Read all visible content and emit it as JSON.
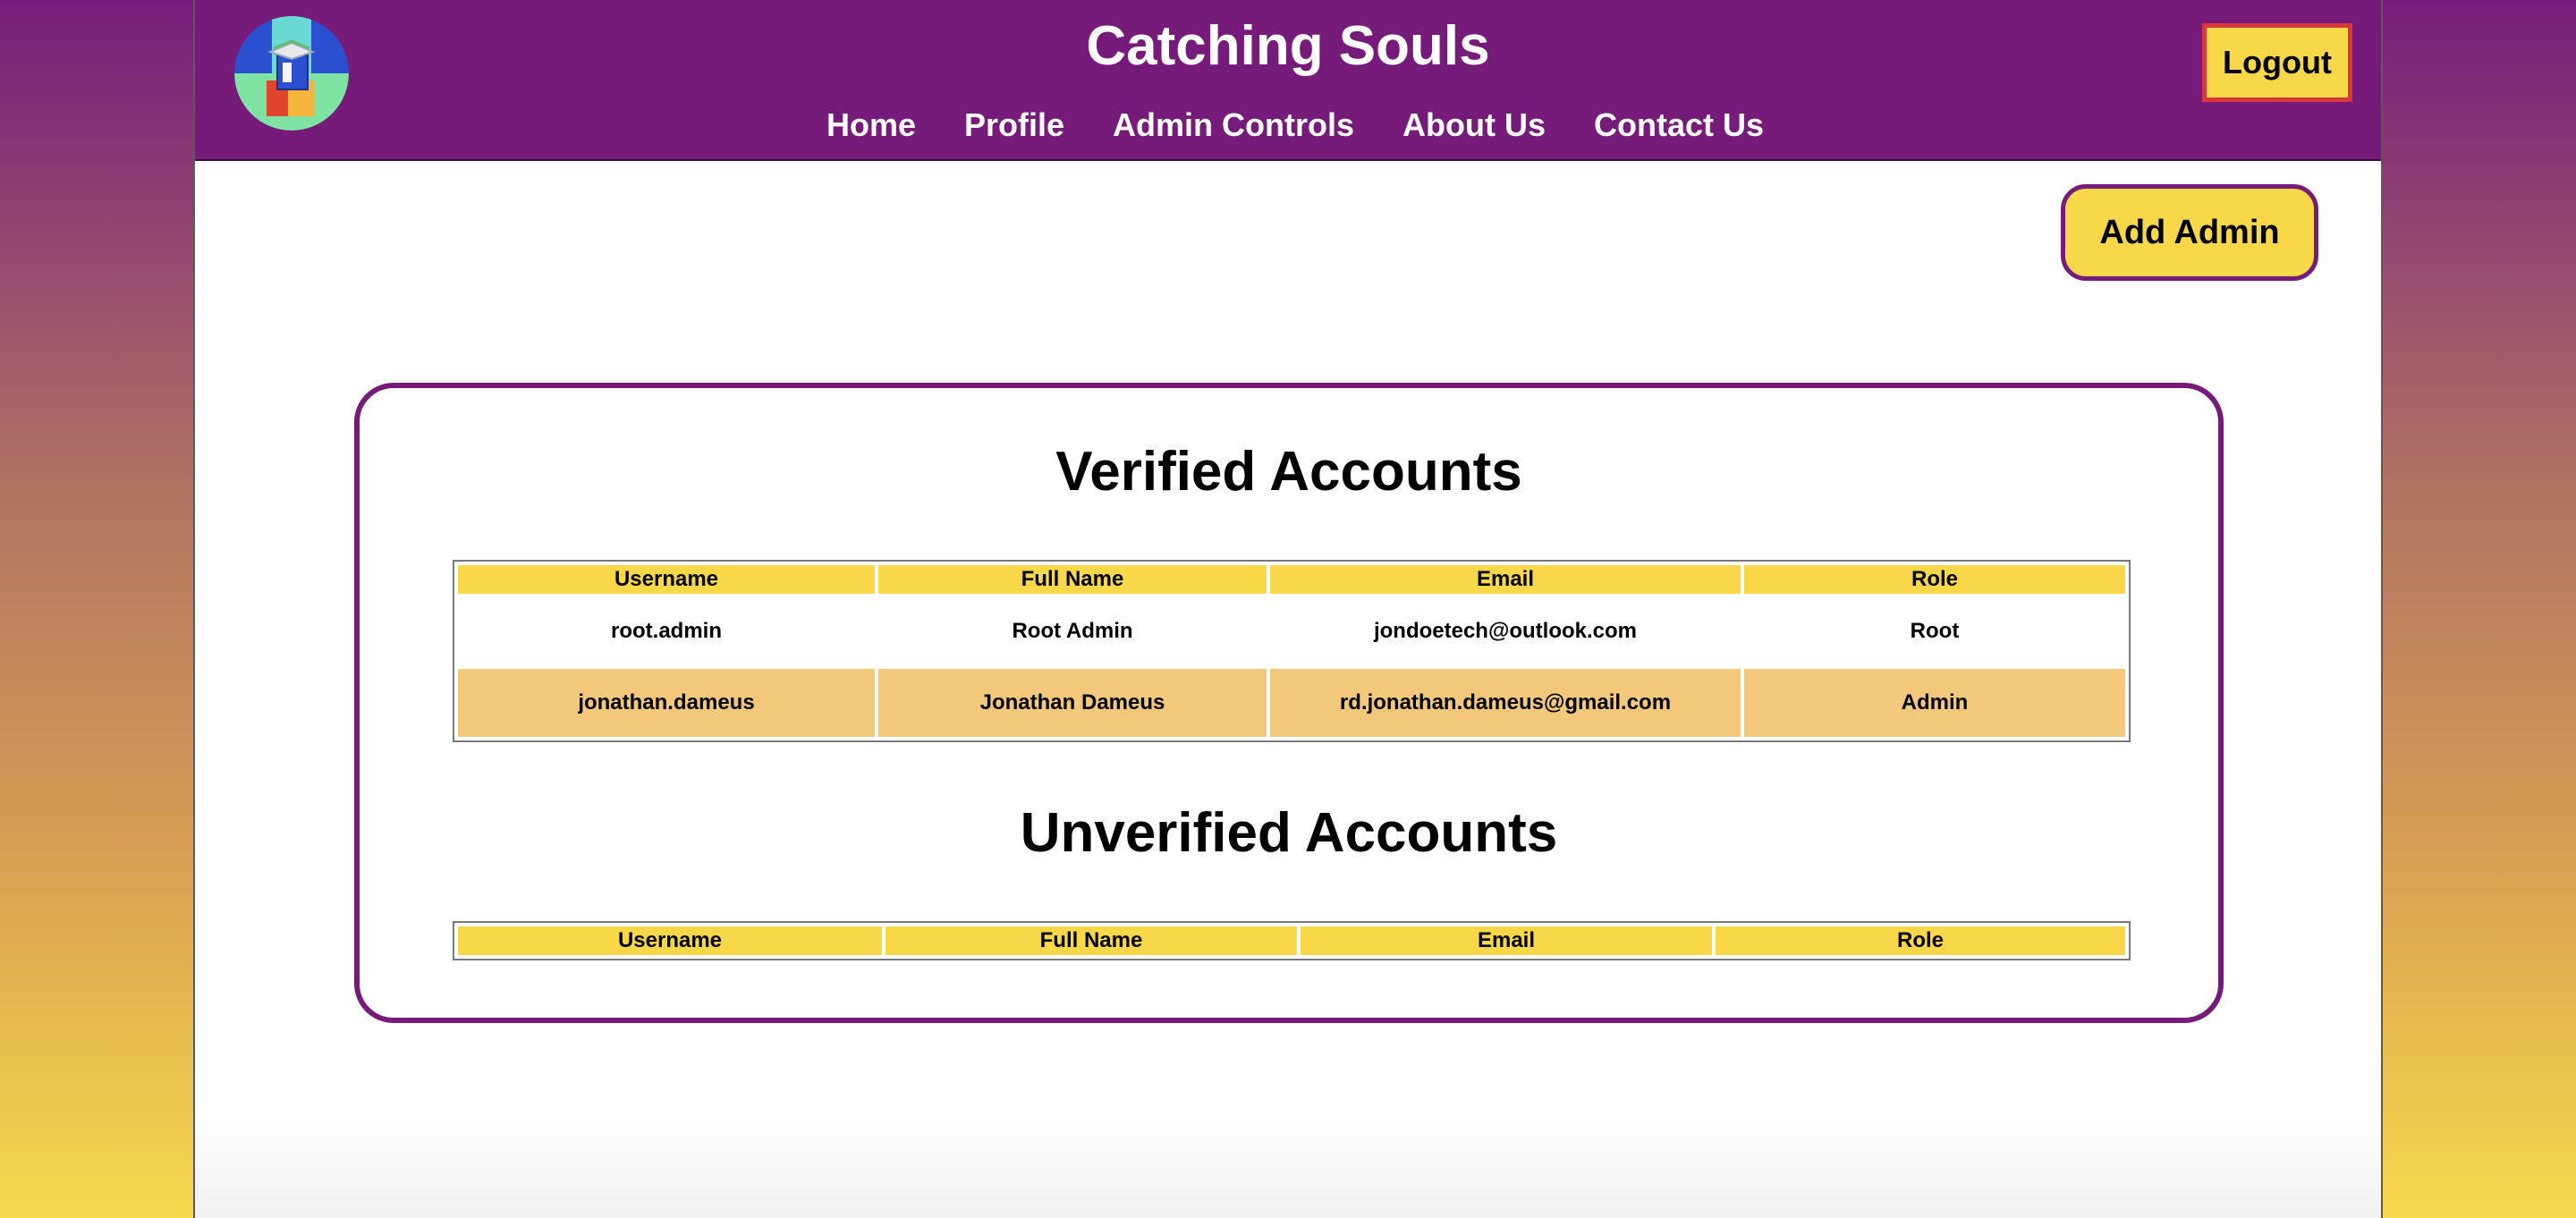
{
  "header": {
    "title": "Catching Souls",
    "nav": [
      {
        "label": "Home"
      },
      {
        "label": "Profile"
      },
      {
        "label": "Admin Controls"
      },
      {
        "label": "About Us"
      },
      {
        "label": "Contact Us"
      }
    ],
    "logout_label": "Logout",
    "logo_icon": "book-and-blocks-logo-icon"
  },
  "actions": {
    "add_admin_label": "Add Admin"
  },
  "verified": {
    "title": "Verified Accounts",
    "columns": [
      "Username",
      "Full Name",
      "Email",
      "Role"
    ],
    "rows": [
      [
        "root.admin",
        "Root Admin",
        "jondoetech@outlook.com",
        "Root"
      ],
      [
        "jonathan.dameus",
        "Jonathan Dameus",
        "rd.jonathan.dameus@gmail.com",
        "Admin"
      ]
    ]
  },
  "unverified": {
    "title": "Unverified Accounts",
    "columns": [
      "Username",
      "Full Name",
      "Email",
      "Role"
    ],
    "rows": []
  },
  "colors": {
    "header_purple": "#771b7a",
    "button_yellow": "#f8d848",
    "logout_border_red": "#d8383a",
    "row_highlight": "#f3c87a"
  }
}
